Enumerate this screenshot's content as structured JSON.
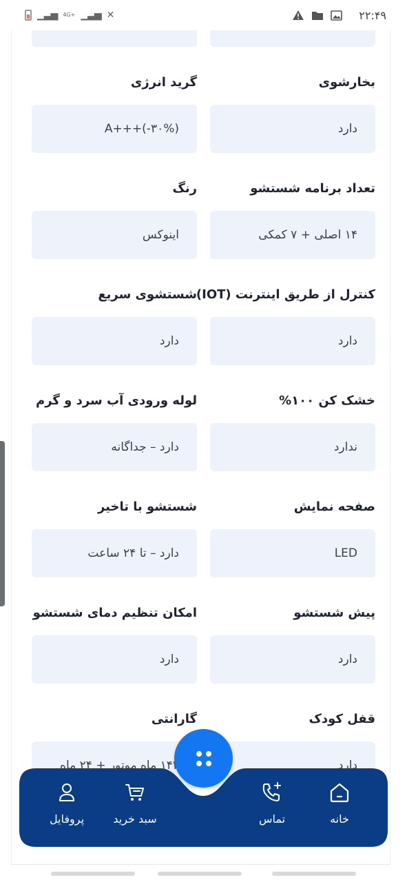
{
  "status_bar": {
    "time": "۲۲:۴۹",
    "network_label": "4G+",
    "icons": [
      "battery-icon",
      "signal-icon",
      "signal-icon",
      "mute-icon",
      "warning-icon",
      "folder-icon",
      "image-icon"
    ]
  },
  "specs": [
    {
      "right": {
        "label": "بخارشوی",
        "value": "دارد"
      },
      "left": {
        "label": "گرید انرژی",
        "value": "A+++(-۳۰%)"
      }
    },
    {
      "right": {
        "label": "تعداد برنامه شستشو",
        "value": "۱۴ اصلی + ۷ کمکی"
      },
      "left": {
        "label": "رنگ",
        "value": "اینوکس"
      }
    },
    {
      "right": {
        "label": "کنترل از طریق اینترنت (IOT)",
        "value": "دارد"
      },
      "left": {
        "label": "شستشوی سریع",
        "value": "دارد"
      }
    },
    {
      "right": {
        "label": "خشک کن ۱۰۰%",
        "value": "ندارد"
      },
      "left": {
        "label": "لوله ورودی آب سرد و گرم",
        "value": "دارد – جداگانه"
      }
    },
    {
      "right": {
        "label": "صفحه نمایش",
        "value": "LED"
      },
      "left": {
        "label": "شستشو با تاخیر",
        "value": "دارد – تا ۲۴ ساعت"
      }
    },
    {
      "right": {
        "label": "پیش شستشو",
        "value": "دارد"
      },
      "left": {
        "label": "امکان تنظیم دمای شستشو",
        "value": "دارد"
      }
    },
    {
      "right": {
        "label": "قفل کودک",
        "value": "دارد"
      },
      "left": {
        "label": "گارانتی",
        "value": "۱۴۲ ماه موتور + ۲۴ ماه"
      }
    }
  ],
  "bottom_nav": {
    "items": [
      {
        "label": "خانه",
        "icon": "home-icon"
      },
      {
        "label": "تماس",
        "icon": "phone-add-icon"
      },
      {
        "label": "سبد خرید",
        "icon": "cart-icon"
      },
      {
        "label": "پروفایل",
        "icon": "user-icon"
      }
    ],
    "fab_icon": "menu-dots-icon"
  },
  "colors": {
    "nav_bg": "#0b3d86",
    "fab": "#1477f2",
    "value_bg": "#eef3fb"
  }
}
